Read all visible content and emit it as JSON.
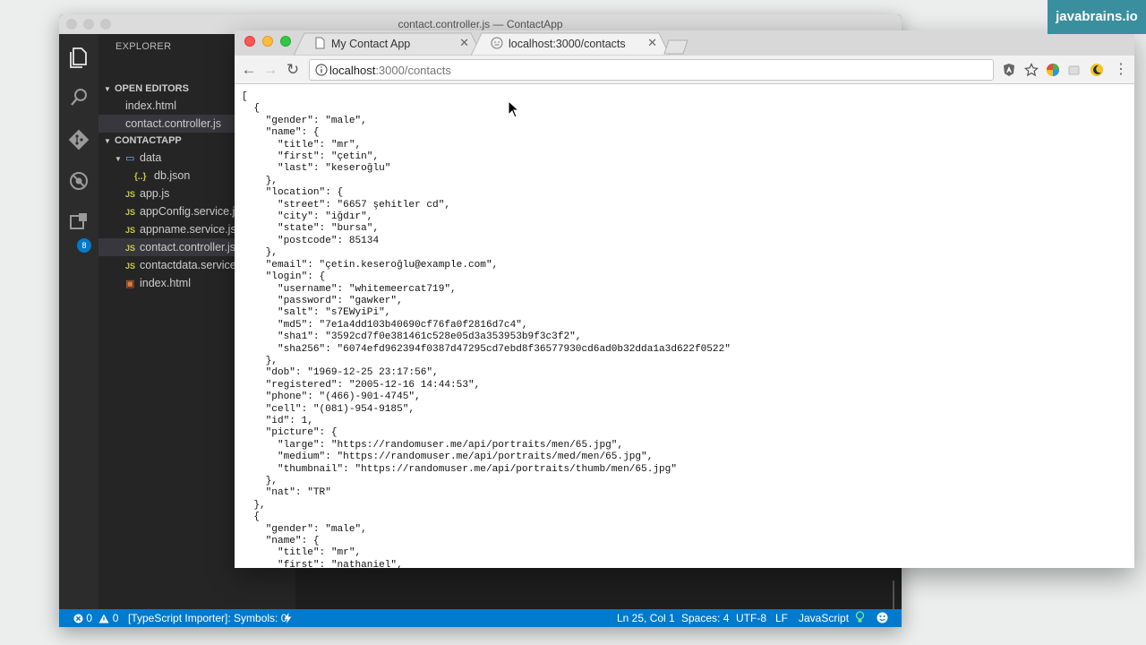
{
  "watermark": "javabrains.io",
  "vscode": {
    "title": "contact.controller.js — ContactApp",
    "explorer_title": "EXPLORER",
    "open_editors_label": "OPEN EDITORS",
    "open_editors": [
      "index.html",
      "contact.controller.js"
    ],
    "project_label": "CONTACTAPP",
    "tree": [
      {
        "label": "data",
        "kind": "folder",
        "indent": 1
      },
      {
        "label": "db.json",
        "kind": "json",
        "indent": 2
      },
      {
        "label": "app.js",
        "kind": "js",
        "indent": 1
      },
      {
        "label": "appConfig.service.js",
        "kind": "js",
        "indent": 1
      },
      {
        "label": "appname.service.js",
        "kind": "js",
        "indent": 1
      },
      {
        "label": "contact.controller.js",
        "kind": "js",
        "indent": 1
      },
      {
        "label": "contactdata.service.js",
        "kind": "js",
        "indent": 1
      },
      {
        "label": "index.html",
        "kind": "html",
        "indent": 1
      }
    ],
    "extensions_badge": "8",
    "status": {
      "errors": "0",
      "warnings": "0",
      "plugin": "[TypeScript Importer]: Symbols: 0",
      "position": "Ln 25, Col 1",
      "spaces": "Spaces: 4",
      "encoding": "UTF-8",
      "eol": "LF",
      "language": "JavaScript"
    }
  },
  "chrome": {
    "tabs": [
      {
        "title": "My Contact App",
        "active": false
      },
      {
        "title": "localhost:3000/contacts",
        "active": true
      }
    ],
    "url_host": "localhost",
    "url_path": ":3000/contacts"
  },
  "json_lines": [
    "[",
    "  {",
    "    \"gender\": \"male\",",
    "    \"name\": {",
    "      \"title\": \"mr\",",
    "      \"first\": \"çetin\",",
    "      \"last\": \"keseroğlu\"",
    "    },",
    "    \"location\": {",
    "      \"street\": \"6657 şehitler cd\",",
    "      \"city\": \"iğdır\",",
    "      \"state\": \"bursa\",",
    "      \"postcode\": 85134",
    "    },",
    "    \"email\": \"çetin.keseroğlu@example.com\",",
    "    \"login\": {",
    "      \"username\": \"whitemeercat719\",",
    "      \"password\": \"gawker\",",
    "      \"salt\": \"s7EWyiPi\",",
    "      \"md5\": \"7e1a4dd103b40690cf76fa0f2816d7c4\",",
    "      \"sha1\": \"3592cd7f0e381461c528e05d3a353953b9f3c3f2\",",
    "      \"sha256\": \"6074efd962394f0387d47295cd7ebd8f36577930cd6ad0b32dda1a3d622f0522\"",
    "    },",
    "    \"dob\": \"1969-12-25 23:17:56\",",
    "    \"registered\": \"2005-12-16 14:44:53\",",
    "    \"phone\": \"(466)-901-4745\",",
    "    \"cell\": \"(081)-954-9185\",",
    "    \"id\": 1,",
    "    \"picture\": {",
    "      \"large\": \"https://randomuser.me/api/portraits/men/65.jpg\",",
    "      \"medium\": \"https://randomuser.me/api/portraits/med/men/65.jpg\",",
    "      \"thumbnail\": \"https://randomuser.me/api/portraits/thumb/men/65.jpg\"",
    "    },",
    "    \"nat\": \"TR\"",
    "  },",
    "  {",
    "    \"gender\": \"male\",",
    "    \"name\": {",
    "      \"title\": \"mr\",",
    "      \"first\": \"nathaniel\","
  ],
  "colors": {
    "vscode_status": "#007acc",
    "watermark": "#3a8f9e",
    "sidebar": "#252526",
    "activity_bar": "#2c2c2c"
  }
}
